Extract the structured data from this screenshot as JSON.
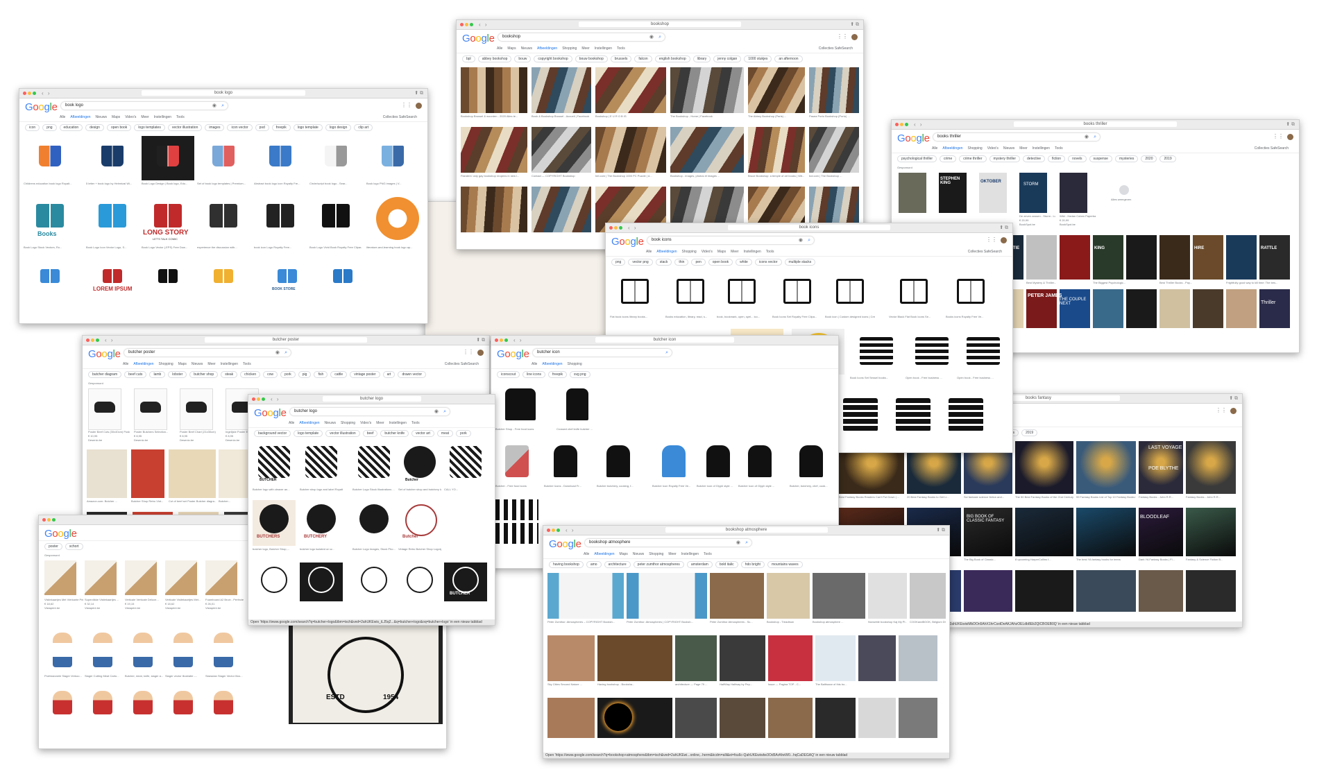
{
  "windows": {
    "book_logo": {
      "url": "book logo",
      "query": "book logo",
      "tabs": [
        "Alle",
        "Afbeeldingen",
        "Nieuws",
        "Maps",
        "Video's",
        "Meer",
        "Instellingen",
        "Tools"
      ],
      "tabs_right": "Collecties   SafeSearch",
      "chips": [
        "icon",
        "png",
        "education",
        "design",
        "open book",
        "logo templates",
        "vector illustration",
        "images",
        "icon vector",
        "psd",
        "freepik",
        "logo template",
        "logo design",
        "clip art"
      ],
      "captions": [
        "Childrens education book logo Royalt...",
        "5 letter + book logo by Helmrizal Wi...",
        "Book Logo Design | Book logo, Edu...",
        "Set of book logo templates | Premium...",
        "Abstract book logo icon Royalty Fre...",
        "Circle/script book logo - Sear...",
        "Book logo PNG images | V...",
        "Book Logo Stock Vectors, Ro...",
        "Book Logo Icon Vector Logo, S...",
        "Book Logo Vector (.EPS) Free Dow...",
        "experience the discussion with...",
        "book icon Logo Royalty Free...",
        "Book Logo Vivid Book Royalty Free Clipar...",
        "literature-and-learning book logo ap..."
      ],
      "book_text_1": "Books",
      "book_text_2": "LONG STORY",
      "book_text_2_sub": "LET'S TALK COMIC",
      "lorem": "LOREM IPSUM",
      "bookstore": "BOOK STORE"
    },
    "bookshop": {
      "url": "bookshop",
      "query": "bookshop",
      "tabs": [
        "Alle",
        "Maps",
        "Nieuws",
        "Afbeeldingen",
        "Shopping",
        "Meer",
        "Instellingen",
        "Tools"
      ],
      "tabs_right": "Collecties   SafeSearch",
      "chips": [
        "bpl",
        "abbey bookshop",
        "bouw",
        "copyright bookshop",
        "bouw bookshop",
        "brussels",
        "falcon",
        "english bookshop",
        "library",
        "jenny colgan",
        "1000 stukjes",
        "an afternoon"
      ],
      "captions": [
        "Bookshop Brussel & woorden - 2020 Alles te...",
        "Book & Bookshop Brussel - Accueil | Facebook",
        "Bookshop | E U R O B IS",
        "The Bookshop - Home | Facebook",
        "The Abbey Bookshop (Paris) ...",
        "Pasea Porto Bookshop (Porto) ...",
        "Flanders' only gay bookshop reopens in new l...",
        "Contact — COPYRIGHT Bookshop",
        "hel.com | The Bookshop 1000 PC Puzzle | d...",
        "Bookshop - images, photos et images ...",
        "Bruce Bookshop: a temple of art books | Wit...",
        "bol.com | The Bookshop ..."
      ]
    },
    "books_thriller": {
      "url": "books thriller",
      "query": "books thriller",
      "tabs": [
        "Alle",
        "Afbeeldingen",
        "Shopping",
        "Video's",
        "Nieuws",
        "Meer",
        "Instellingen",
        "Tools"
      ],
      "tabs_right": "Collecties   SafeSearch",
      "chips": [
        "psychological thriller",
        "crime",
        "crime thriller",
        "mystery thriller",
        "detective",
        "fiction",
        "novels",
        "suspense",
        "mysteries",
        "2020",
        "2019"
      ],
      "sponsored": "Gesponsord",
      "prices": [
        "De zeven zussen - Storm - Lucinda...",
        "Wild - Harlan Coben Paperback..."
      ],
      "price_values": [
        "€ 20,99",
        "€ 20,99"
      ],
      "stores": [
        "BookSpot.be",
        "BookSpot.be"
      ],
      "more": "Alles weergeven",
      "covers": [
        "STEPHEN KING",
        "OKTOBER",
        "STORM",
        "SILEN PATIE",
        "SNAP",
        "KING",
        "HIRE",
        "RATTLE",
        "PETER JAMES",
        "THE COUPLE NEXT",
        "Thriller"
      ],
      "captions": [
        "Books of...",
        "Best Thrillers and Crime Fiction 2018...",
        "Best Mystery & Thriller...",
        "The Biggest Psychologic...",
        "Best Thriller Books - Pay...",
        "Frightfully good way to kill time: The bes..."
      ]
    },
    "book_icons": {
      "url": "book icons",
      "query": "book icons",
      "tabs": [
        "Alle",
        "Afbeeldingen",
        "Shopping",
        "Video's",
        "Maps",
        "Meer",
        "Instellingen",
        "Tools"
      ],
      "tabs_right": "Collecties   SafeSearch",
      "chips": [
        "png",
        "vector png",
        "stack",
        "thin",
        "pen",
        "open book",
        "white",
        "icons vector",
        "multiple stacks"
      ],
      "captions": [
        "Flat book icons library books...",
        "Books education, library, read, s...",
        "book, bookmark, open, spel... ico...",
        "Book Icons Set Royalty Free Clipa...",
        "Book icon | Custom designed icons | Creative...",
        "Vector Black Flat Book Icons Se...",
        "Books icons Royalty Free Ve...",
        "Book | Free Icon",
        "Books stack of three - Free education icons",
        "Book icons set - Sessel books & business",
        "Book free vector icons desi...",
        "Book Icons Set Sessel books...",
        "Open book - Free business ...",
        "Open book - Free business ..."
      ]
    },
    "books_fantasy": {
      "url": "books fantasy",
      "query": "books fantasy",
      "tabs": [
        "Instellingen",
        "Tools"
      ],
      "chips": [
        "series",
        "middle school",
        "trilogy",
        "calculating stars",
        "magic",
        "reads",
        "marion james",
        "2019"
      ],
      "covers": [
        "SHADOW BONE",
        "LAST VOYAGE",
        "POE BLYTHE",
        "BIG BOOK OF CLASSIC FANTASY",
        "BLOODLEAF"
      ],
      "captions": [
        "Best Fantasy Books Readers Can't Put Down | ...",
        "20 Best Fantasy Books to Get Li...",
        "Sci fantasie science fiction and...",
        "The 50 Best Fantasy Books of the 21st Century (ld...",
        "99 Fantasy Books List of Top 10 Fantasy Books for Yo...",
        "Fantasy Books - John R.R...",
        "9 Best Fantasy Books of the Last Decade | Why To Read",
        "The Books of Caledor...",
        "The Big Book of Classic...",
        "8 upcoming HarperCollins f...",
        "The best YA fantasy books for teens",
        "Dark YA Fantasy Books | Fl...",
        "Fantasy & Science Fiction B..."
      ],
      "status": "Open 'https://www.google.com/search?q=books+fantasy&tbm=isch&ved=2ahUKEwisiMbDOn5AhX1hrCsxtDeAKJAhzOELdb8Eb2QlCBOEB0Q' in een nieuw tabblad"
    },
    "butcher_poster": {
      "url": "butcher poster",
      "query": "butcher poster",
      "tabs": [
        "Alle",
        "Afbeeldingen",
        "Shopping",
        "Maps",
        "Nieuws",
        "Meer",
        "Instellingen",
        "Tools"
      ],
      "tabs_right": "Collecties   SafeSearch",
      "chips": [
        "butcher diagram",
        "beef cuts",
        "lamb",
        "lobster",
        "butcher shop",
        "steak",
        "chicken",
        "cow",
        "pork",
        "pig",
        "fish",
        "cattle",
        "vintage poster",
        "art",
        "drawn vector"
      ],
      "sponsored": "Gesponsord",
      "products": [
        "Poster Beef Cuts (30x40cm) Posters",
        "Poster Butchers Selection...",
        "Poster Beef Chart (21x30cm)",
        "Ingelijste Poster Enclak..."
      ],
      "product_prices": [
        "€ 10,95",
        "€ 8,95",
        "€ 8,95",
        "€ 8,95"
      ],
      "stores": [
        "Desenio.be",
        "Desenio.be",
        "Desenio.be",
        "Desenio.be"
      ],
      "captions": [
        "Amazon.com: Butcher ...",
        "Butcher Shop Retro Vint...",
        "Cut of beef set Poster Butcher diagra...",
        "Butcher..."
      ]
    },
    "butcher_icon": {
      "url": "butcher icon",
      "query": "butcher icon",
      "tabs": [
        "Alle",
        "Afbeeldingen",
        "Shopping"
      ],
      "chips": [
        "iconscout",
        "line icons",
        "freepik",
        "svg png"
      ],
      "captions": [
        "Butcher Shop - Free food icons",
        "Crossed chef knife butcher ...",
        "Butcher - Free food icons",
        "Butcher Icons - Download Fr...",
        "Butcher butchery, cooking, f...",
        "Butcher Icon Royalty Free Ve...",
        "Butcher icon of Glyph style ...",
        "Butcher Icon of Glyph style ...",
        "Butcher, butchery, chef, cook..."
      ]
    },
    "butcher_logo": {
      "url": "butcher logo",
      "query": "butcher logo",
      "tabs": [
        "Alle",
        "Afbeeldingen",
        "Nieuws",
        "Shopping",
        "Video's",
        "Meer",
        "Instellingen",
        "Tools"
      ],
      "chips": [
        "background vector",
        "logo template",
        "vector illustration",
        "beef",
        "butcher knife",
        "vector art",
        "meat",
        "pork"
      ],
      "logos": [
        "BUTCHER",
        "Butcher",
        "BUTCHERS",
        "BUTCHERY",
        "Butcher",
        "BUTCHER"
      ],
      "captions": [
        "Butcher logo with cleaver an...",
        "Butcher shop logo and label Royalty Fr...",
        "Butcher Logo Stock Illustrations ...",
        "Set of butcher shop and butchery lab...",
        "CALL YO...",
        "butcher logo, Butcher Shop,...",
        "butcher logo isolated on w...",
        "Butcher Logo Images, Stock Pho...",
        "Vintage Retro Butcher Shop Logotype: Cl..."
      ],
      "status": "Open 'https://www.google.com/search?q=butcher+logo&tbm=isch&ved=2ahUKEwis_iLJ5q2...&q=butcher+logo&oq=butcher+logo' in een nieuw tabblad"
    },
    "butcher_shop": {
      "url": "butcher shop",
      "query": "",
      "chips": [
        "poster",
        "schort"
      ],
      "sponsored": "Gesponsord",
      "products": [
        "Visitekaartjes Met Vierkante Print ...",
        "Superdikke Visitekaartjes ...",
        "Verticale Verticale Deluxe...",
        "Verticale Visitekaartjes Met...",
        "Foamboard A2 Bruin - Perfecte ..."
      ],
      "product_prices": [
        "€ 18,62",
        "€ 32,14",
        "€ 19,15",
        "€ 18,62",
        "€ 26,01"
      ],
      "stores": [
        "Vistaprint.be",
        "Vistaprint.be",
        "Vistaprint.be",
        "Vistaprint.be",
        "Vistaprint.be"
      ],
      "captions": [
        "Professionele Slager Verkoo...",
        "Slager Cutting Meat Carto...",
        "Butcher, meat, knife, slager a...",
        "Slager vector illustratie -...",
        "Slaeadan Slager Vector Illus..."
      ],
      "estd_left": "ESTD",
      "estd_right": "1954"
    },
    "bookshop_atmosphere": {
      "url": "bookshop atmosphere",
      "query": "bookshop atmosphere",
      "tabs": [
        "Alle",
        "Afbeeldingen",
        "Maps",
        "Nieuws",
        "Shopping",
        "Meer",
        "Instellingen",
        "Tools"
      ],
      "chips": [
        "having bookshop",
        "amo",
        "architecture",
        "peter zumthor atmospheres",
        "amsterdam",
        "bold italic",
        "hdo bright",
        "mountains waves"
      ],
      "captions": [
        "Peter Zumthor: Atmospheres – COPYRIGHT Booksh...",
        "Peter Zumthor: Atmospheres | COPYRIGHT Booksh...",
        "Peter Zumthor Atmospheres - Sc...",
        "Bookshop - Treadbuw",
        "Bookshop atmosphere ...",
        "Nonseble bookshop Kaj My Pl...",
        "COOKandBOOK, Belgium Different books, diff...",
        "Sky Cities Second Nature ...",
        "Having bookshop - Booksha...",
        "architecture — Page 79 ...",
        "HalfWay Halfway by Pep...",
        "Issue — Pagina TOP - C...",
        "The Balthazar of this bo..."
      ],
      "status": "Open 'https://www.google.com/search?q=bookshop+atmosphere&tbm=isch&ved=2ahUKEwi...online,..herm&kcdm=alli&ei=fsu6c-QahUKEwiwbe3Od5ArAheW0...hqCaDEGAQ' in een nieuw tabblad"
    }
  },
  "icons": [
    "apps-icon",
    "avatar-icon",
    "search-icon",
    "camera-icon",
    "back-icon",
    "forward-icon",
    "tab-icon",
    "share-icon"
  ]
}
